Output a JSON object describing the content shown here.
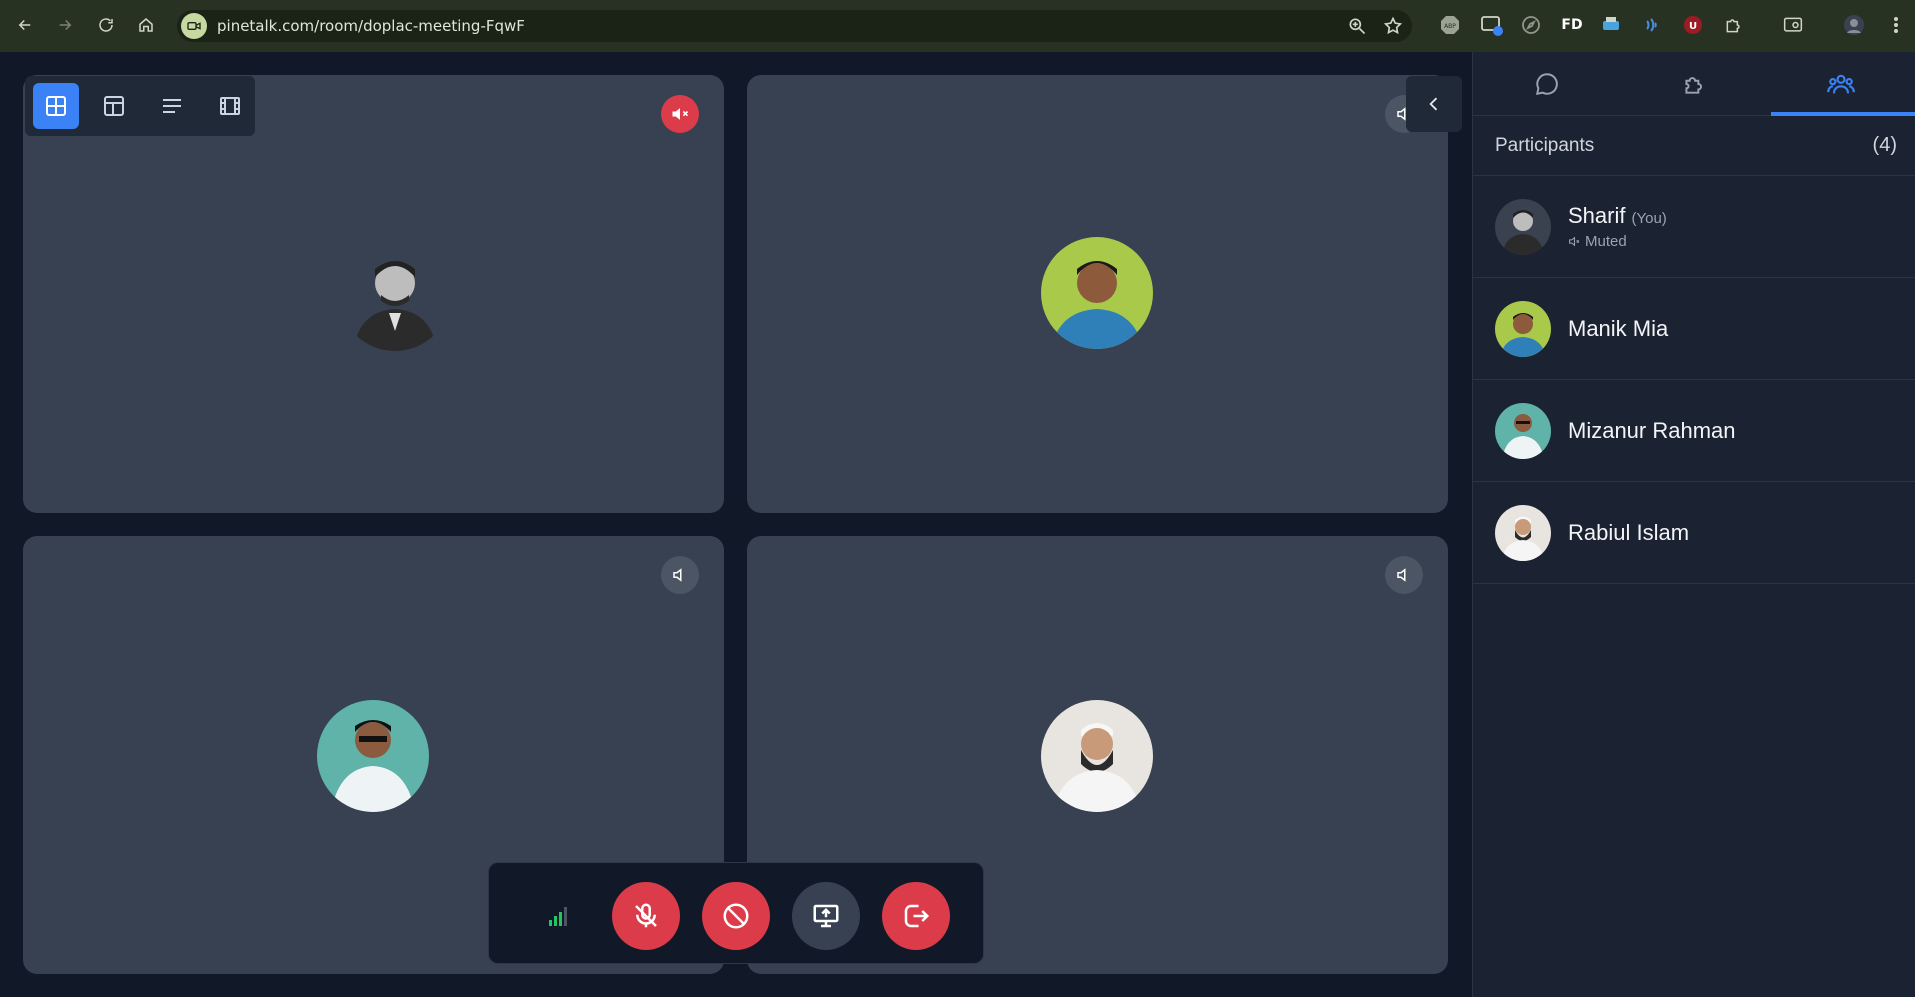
{
  "browser": {
    "url": "pinetalk.com/room/doplac-meeting-FqwF",
    "extensions": [
      "abp-icon",
      "picture-in-picture-icon",
      "compass-icon",
      "fd-icon",
      "printer-icon",
      "wave-icon",
      "ublock-icon",
      "puzzle-icon"
    ],
    "ext_fd_label": "FD",
    "ext_abp_label": "ABP",
    "ext_u_label": "U"
  },
  "layout_options": [
    "grid-view",
    "sidebar-view",
    "list-view",
    "filmstrip-view"
  ],
  "tiles": [
    {
      "name": "Sharif",
      "muted": true,
      "avatar_bg": "#3a4250",
      "photo": "grayscale"
    },
    {
      "name": "Manik Mia",
      "muted": false,
      "avatar_bg": "#a9c94a",
      "photo": "color"
    },
    {
      "name": "Mizanur Rahman",
      "muted": false,
      "avatar_bg": "#5fb3a9",
      "photo": "color"
    },
    {
      "name": "Rabiul Islam",
      "muted": false,
      "avatar_bg": "#e8e4df",
      "photo": "color"
    }
  ],
  "controls": {
    "signal": "connection-quality-icon",
    "mic": "mic-off-icon",
    "camera": "camera-blocked-icon",
    "share": "screen-share-icon",
    "leave": "leave-icon"
  },
  "panel": {
    "tabs": [
      "chat",
      "extensions",
      "participants"
    ],
    "active_tab": "participants",
    "title": "Participants",
    "count": "(4)",
    "participants": [
      {
        "name": "Sharif",
        "you": "(You)",
        "status": "Muted"
      },
      {
        "name": "Manik Mia"
      },
      {
        "name": "Mizanur Rahman"
      },
      {
        "name": "Rabiul Islam"
      }
    ]
  },
  "colors": {
    "accent": "#3b82f6",
    "danger": "#dc3c4a",
    "signal": "#22c55e"
  }
}
